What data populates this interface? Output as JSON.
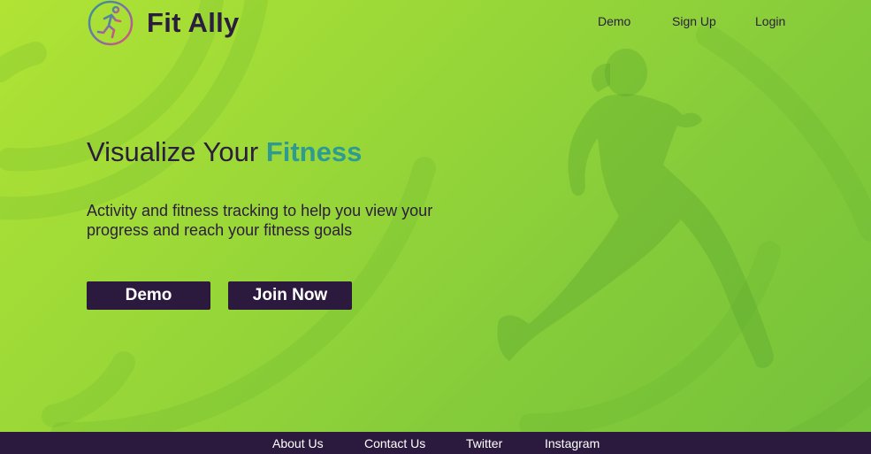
{
  "brand": {
    "name": "Fit Ally",
    "logo_icon": "running-person-icon"
  },
  "nav": {
    "demo": "Demo",
    "signup": "Sign Up",
    "login": "Login"
  },
  "hero": {
    "title_prefix": "Visualize Your ",
    "title_accent": "Fitness",
    "subtitle": "Activity and fitness tracking to help you view your progress and reach your fitness goals",
    "demo_button": "Demo",
    "join_button": "Join Now",
    "background_figure": "runner-silhouette"
  },
  "footer": {
    "links": [
      "About Us",
      "Contact Us",
      "Twitter",
      "Instagram"
    ]
  },
  "colors": {
    "background_start": "#b0e334",
    "background_end": "#74c13b",
    "dark_purple": "#2c1a3e",
    "accent_teal": "#2e9a90",
    "text_dark": "#2b1d3d"
  }
}
